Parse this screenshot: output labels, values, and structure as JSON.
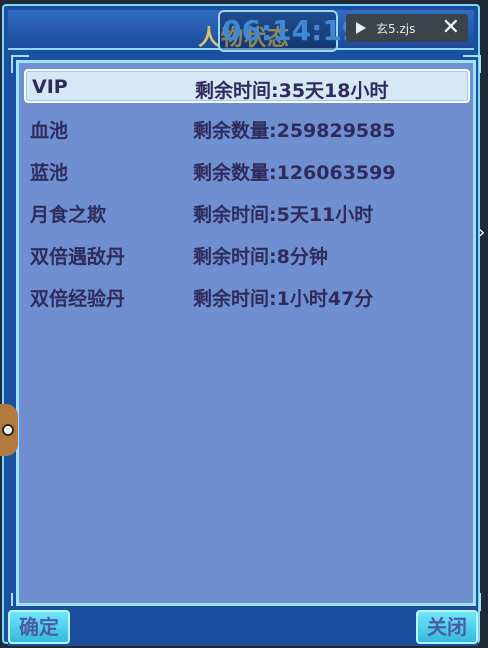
{
  "window": {
    "title": "人物状态",
    "clock": "06:14:19"
  },
  "media": {
    "label": "玄5.zjs",
    "close_glyph": "✕"
  },
  "list": {
    "rows": [
      {
        "name": "VIP",
        "value": "剩余时间:35天18小时"
      },
      {
        "name": "血池",
        "value": "剩余数量:259829585"
      },
      {
        "name": "蓝池",
        "value": "剩余数量:126063599"
      },
      {
        "name": "月食之欺",
        "value": "剩余时间:5天11小时"
      },
      {
        "name": "双倍遇敌丹",
        "value": "剩余时间:8分钟"
      },
      {
        "name": "双倍经验丹",
        "value": "剩余时间:1小时47分"
      }
    ]
  },
  "buttons": {
    "confirm": "确定",
    "close": "关闭"
  },
  "icons": {
    "play": "play-icon",
    "close": "close-icon",
    "arrow": "chevron-right-icon",
    "mascot": "cat-mascot-icon"
  }
}
